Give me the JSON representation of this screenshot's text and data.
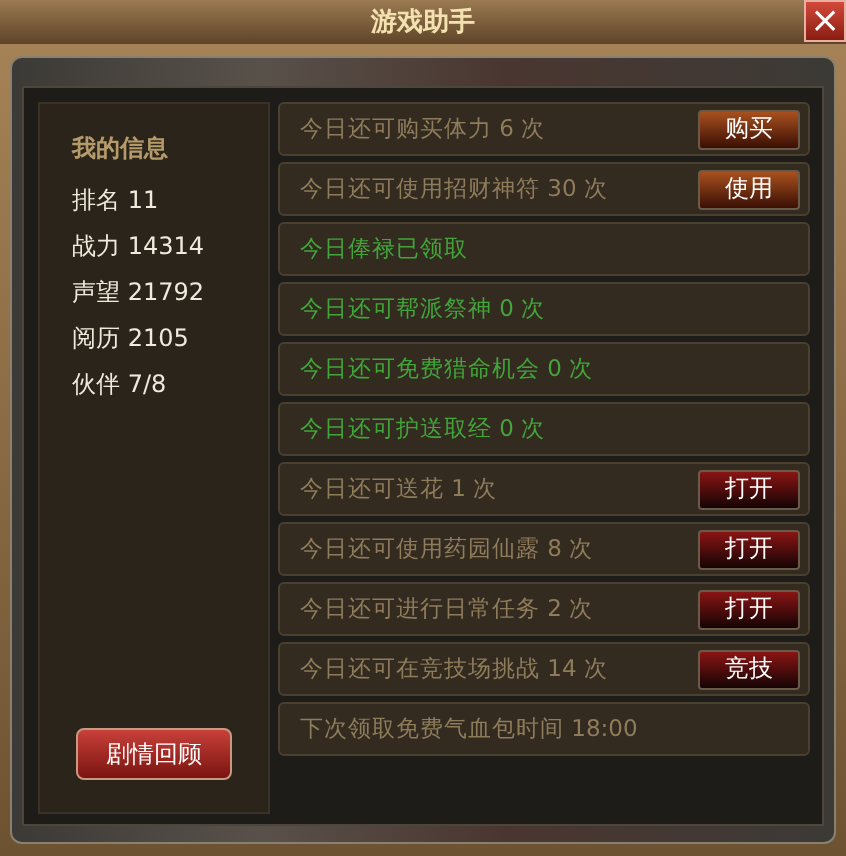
{
  "window": {
    "title": "游戏助手",
    "close": "×"
  },
  "profile": {
    "heading": "我的信息",
    "stats": [
      {
        "label": "排名",
        "value": "11"
      },
      {
        "label": "战力",
        "value": "14314"
      },
      {
        "label": "声望",
        "value": "21792"
      },
      {
        "label": "阅历",
        "value": "2105"
      },
      {
        "label": "伙伴",
        "value": "7/8"
      }
    ],
    "button": "剧情回顾"
  },
  "tasks": [
    {
      "kind": "purchase",
      "done": false,
      "text": "今日还可购买体力 6 次",
      "button": "购买"
    },
    {
      "kind": "purchase",
      "done": false,
      "text": "今日还可使用招财神符 30 次",
      "button": "使用"
    },
    {
      "kind": "info",
      "done": true,
      "text": "今日俸禄已领取"
    },
    {
      "kind": "info",
      "done": true,
      "text": "今日还可帮派祭神 0 次"
    },
    {
      "kind": "info",
      "done": true,
      "text": "今日还可免费猎命机会 0 次"
    },
    {
      "kind": "info",
      "done": true,
      "text": "今日还可护送取经 0 次"
    },
    {
      "kind": "shortcut",
      "done": false,
      "text": "今日还可送花 1 次",
      "button": "打开"
    },
    {
      "kind": "shortcut",
      "done": false,
      "text": "今日还可使用药园仙露 8 次",
      "button": "打开"
    },
    {
      "kind": "shortcut",
      "done": false,
      "text": "今日还可进行日常任务 2 次",
      "button": "打开"
    },
    {
      "kind": "shortcut",
      "done": false,
      "text": "今日还可在竞技场挑战 14 次",
      "button": "竞技"
    },
    {
      "kind": "info",
      "done": false,
      "text": "下次领取免费气血包时间 18:00"
    }
  ]
}
